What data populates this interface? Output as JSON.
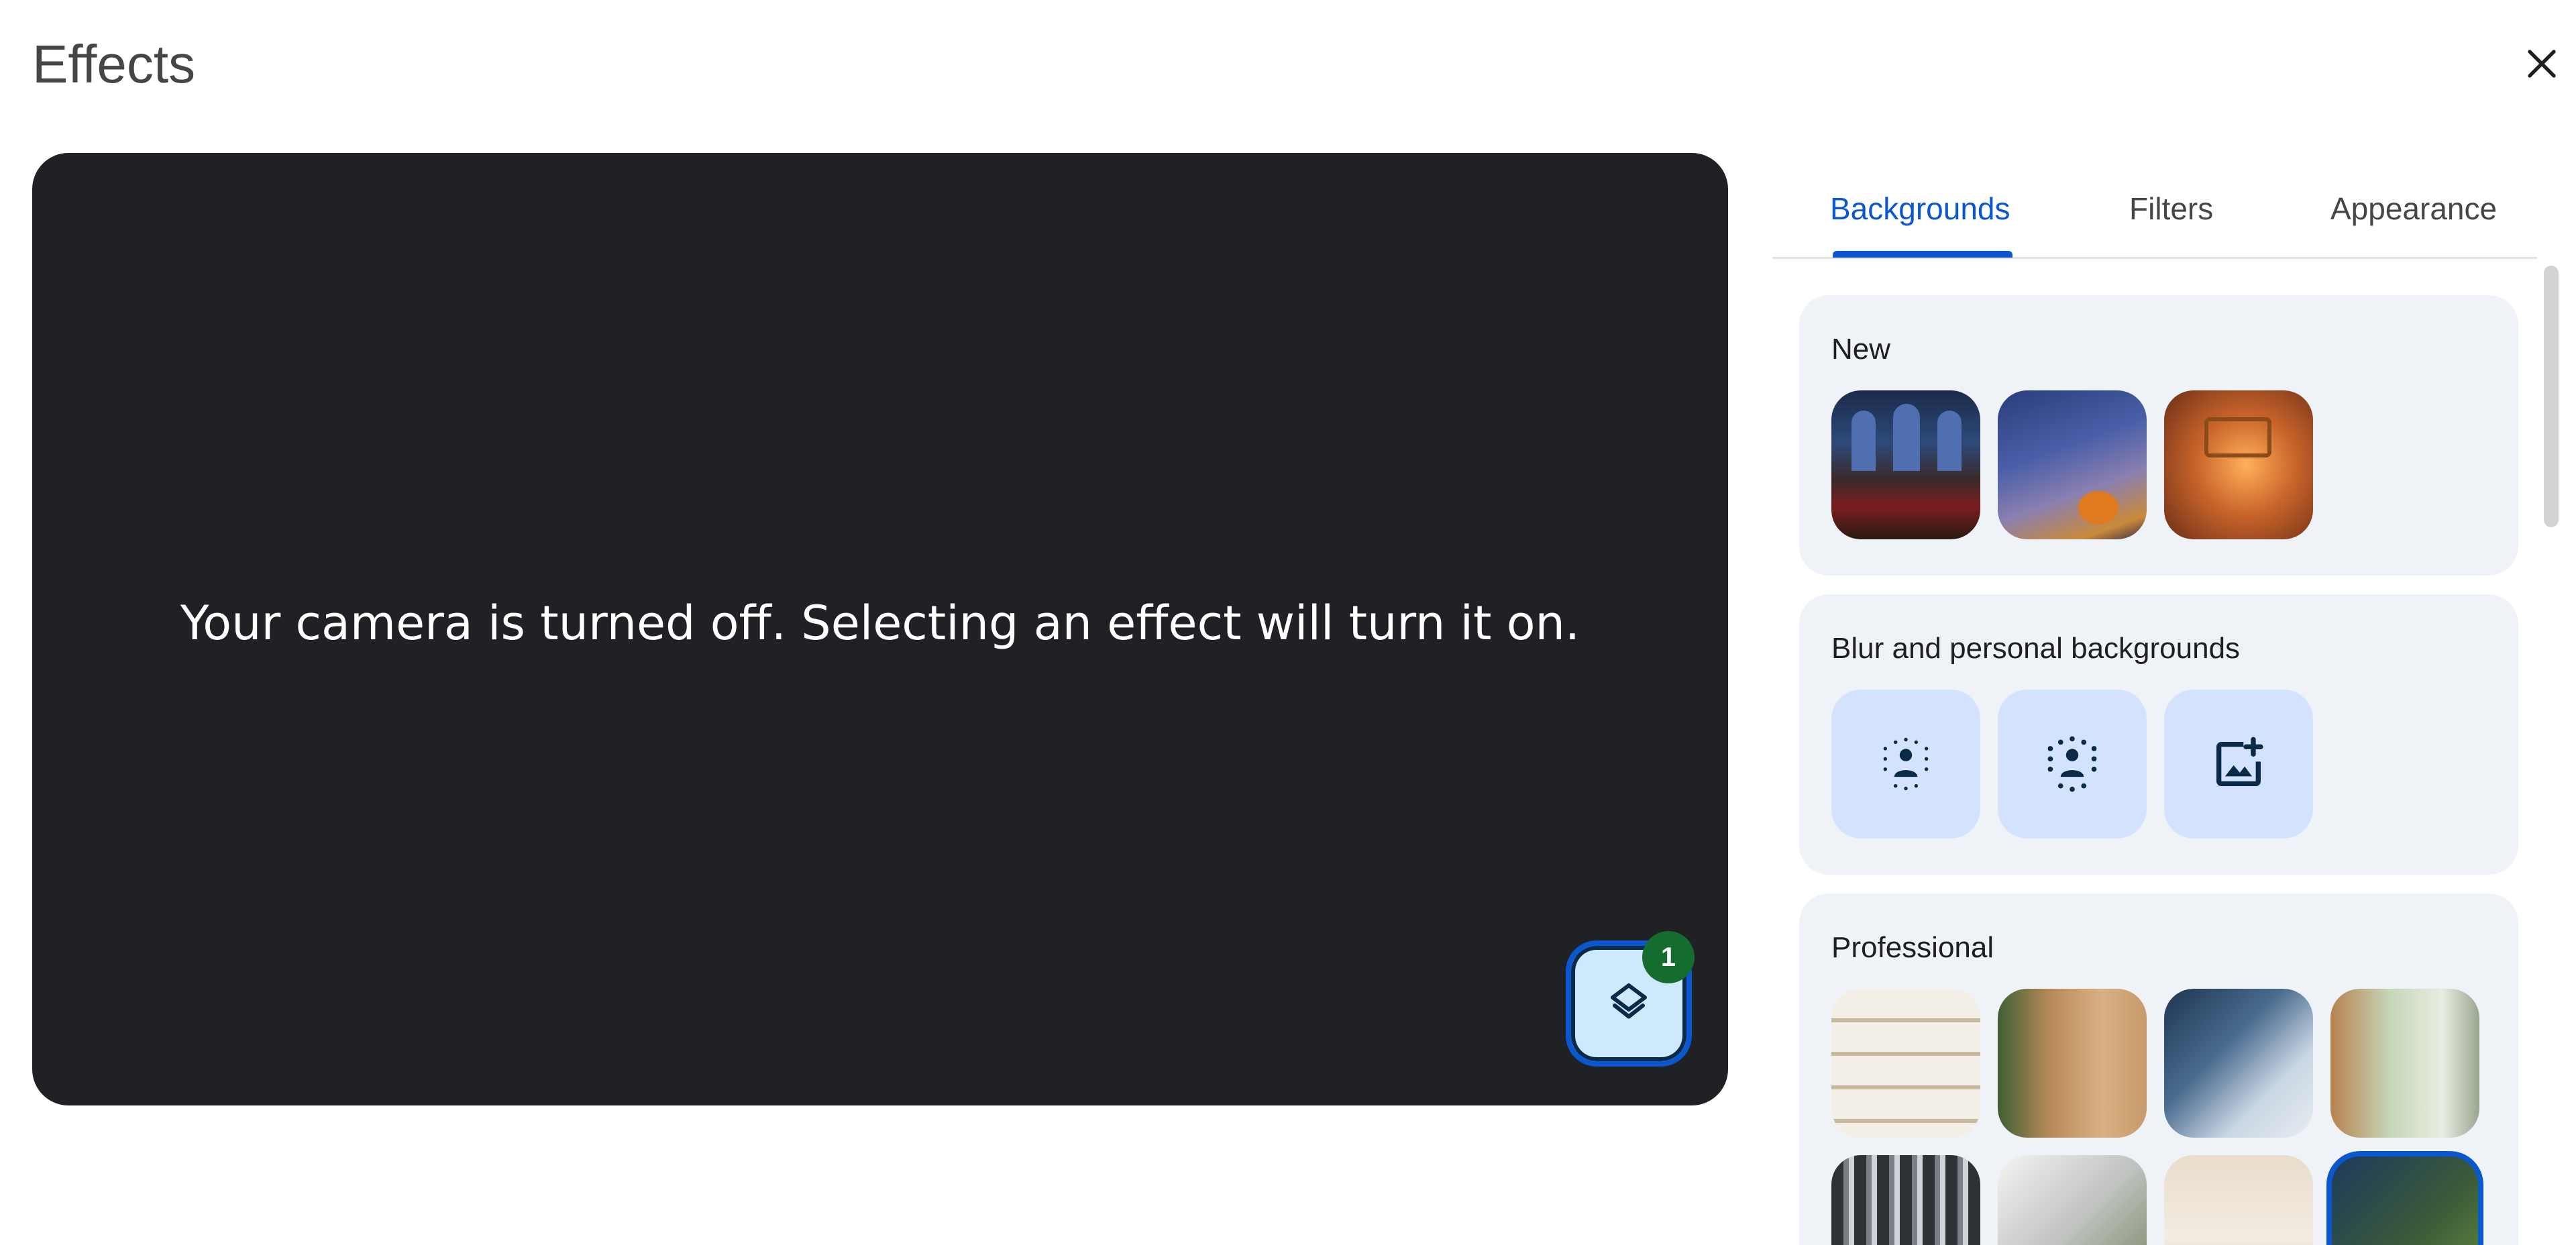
{
  "dialog": {
    "title": "Effects",
    "close_icon": "close-icon"
  },
  "preview": {
    "message": "Your camera is turned off. Selecting an effect will turn it on.",
    "layers_badge": "1",
    "layers_icon": "layers-icon"
  },
  "tabs": [
    {
      "label": "Backgrounds",
      "active": true
    },
    {
      "label": "Filters",
      "active": false
    },
    {
      "label": "Appearance",
      "active": false
    }
  ],
  "sections": {
    "new": {
      "title": "New",
      "items": [
        "castle-hall-background",
        "spooky-tree-background",
        "cozy-room-background"
      ]
    },
    "blur": {
      "title": "Blur and personal backgrounds",
      "items": [
        "slight-blur-icon",
        "blur-icon",
        "add-image-icon"
      ]
    },
    "professional": {
      "title": "Professional",
      "items": [
        "bookshelf-background",
        "wood-wall-background",
        "city-window-background",
        "sage-room-background",
        "library-background",
        "concrete-background",
        "beige-room-background",
        "jungle-window-background"
      ],
      "selected_index": 7
    }
  },
  "colors": {
    "accent": "#0b57d0",
    "badge": "#146c2e",
    "preview_bg": "#202124",
    "section_bg": "#eff2f7",
    "icon_tile_bg": "#d3e3fd"
  }
}
